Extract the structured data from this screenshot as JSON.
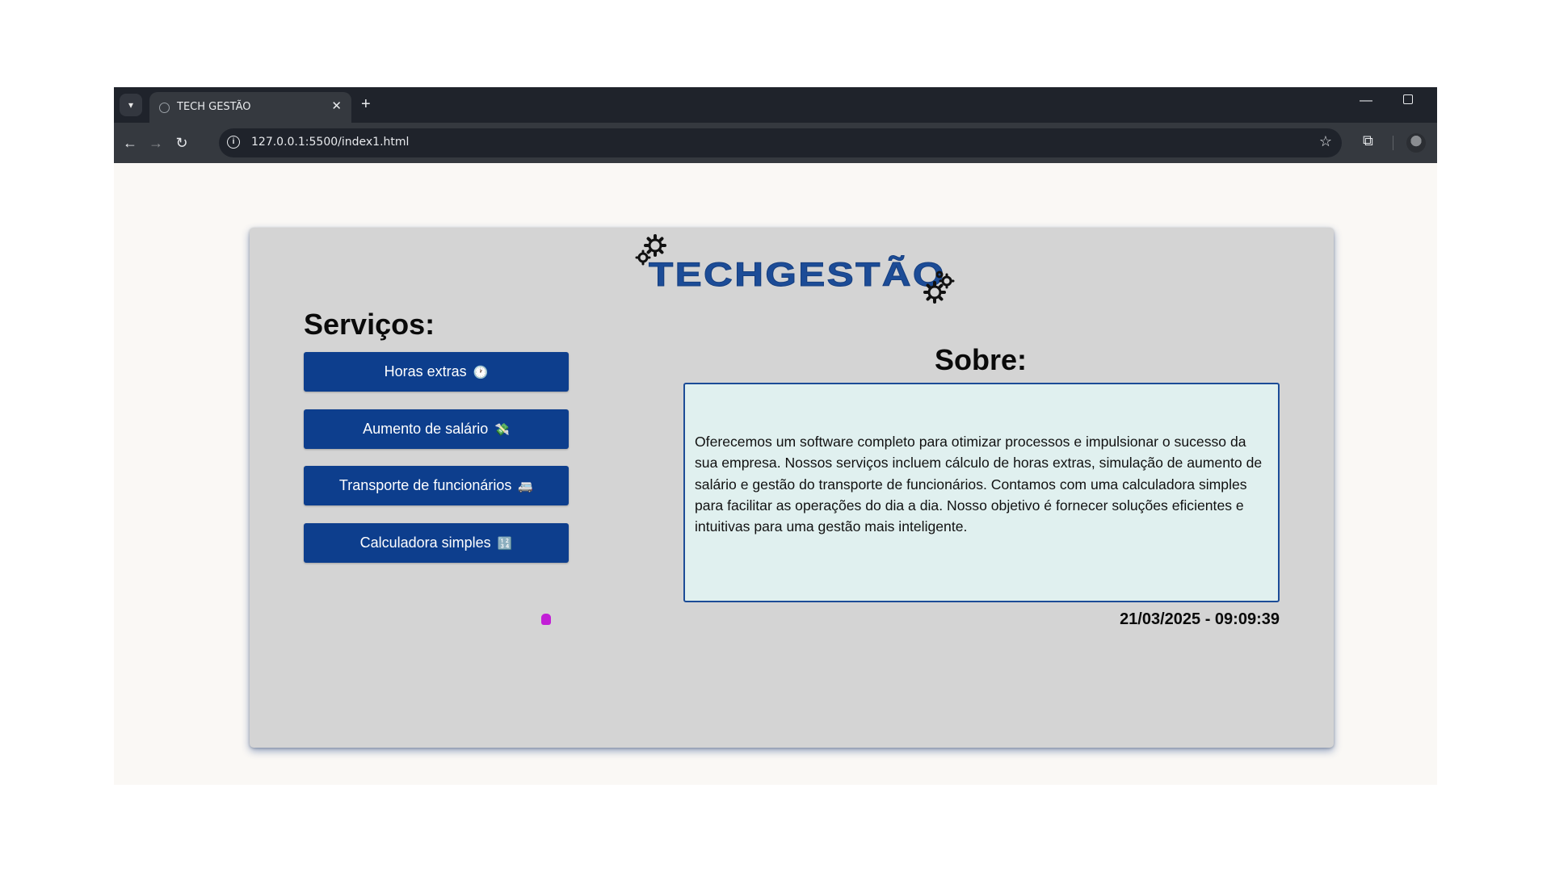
{
  "browser": {
    "tab_title": "TECH GESTÃO",
    "tab_close": "✕",
    "new_tab": "+",
    "url": "127.0.0.1:5500/index1.html"
  },
  "page": {
    "logo_text": "TECHGESTÃO",
    "services_title": "Serviços:",
    "services": [
      {
        "label": "Horas extras",
        "icon": "🕐"
      },
      {
        "label": "Aumento de salário",
        "icon": "💸"
      },
      {
        "label": "Transporte de funcionários",
        "icon": "🚐"
      },
      {
        "label": "Calculadora simples",
        "icon": "🔢"
      }
    ],
    "about_title": "Sobre:",
    "about_text": "Oferecemos um software completo para otimizar processos e impulsionar o sucesso da sua empresa. Nossos serviços incluem cálculo de horas extras, simulação de aumento de salário e gestão do transporte de funcionários. Contamos com uma calculadora simples para facilitar as operações do dia a dia. Nosso objetivo é fornecer soluções eficientes e intuitivas para uma gestão mais inteligente.",
    "datetime": "21/03/2025 - 09:09:39"
  },
  "colors": {
    "brand_blue": "#0d3e8d",
    "logo_blue": "#1c4c97",
    "card_bg": "#d4d4d4",
    "about_bg": "#e0f0ef"
  }
}
